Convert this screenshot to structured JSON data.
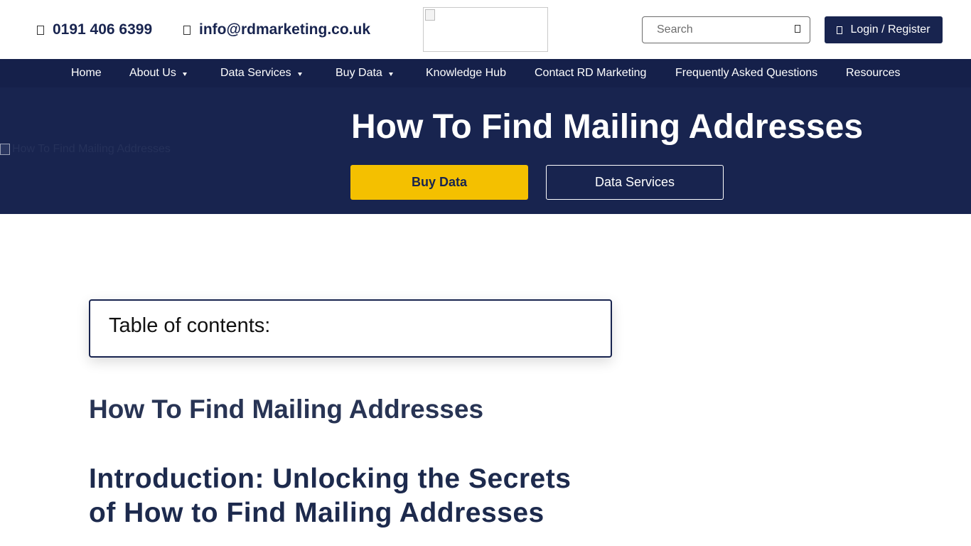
{
  "header": {
    "phone": "0191 406 6399",
    "email": "info@rdmarketing.co.uk",
    "search_placeholder": "Search",
    "login_label": "Login / Register"
  },
  "nav": {
    "items": [
      {
        "label": "Home",
        "has_dropdown": false
      },
      {
        "label": "About Us",
        "has_dropdown": true
      },
      {
        "label": "Data Services",
        "has_dropdown": true
      },
      {
        "label": "Buy Data",
        "has_dropdown": true
      },
      {
        "label": "Knowledge Hub",
        "has_dropdown": false
      },
      {
        "label": "Contact RD Marketing",
        "has_dropdown": false
      },
      {
        "label": "Frequently Asked Questions",
        "has_dropdown": false
      },
      {
        "label": "Resources",
        "has_dropdown": false
      }
    ]
  },
  "hero": {
    "image_alt": "How To Find Mailing Addresses",
    "title": "How To Find Mailing Addresses",
    "primary_button": "Buy Data",
    "secondary_button": "Data Services"
  },
  "content": {
    "toc_label": "Table of contents:",
    "subtitle": "How To Find Mailing Addresses",
    "intro_heading": "Introduction: Unlocking the Secrets of How to Find Mailing Addresses"
  },
  "colors": {
    "navy": "#18244f",
    "accent_yellow": "#f4c000"
  },
  "icons": {
    "phone": "phone-icon",
    "email": "email-icon",
    "search": "search-icon",
    "login": "user-icon"
  }
}
